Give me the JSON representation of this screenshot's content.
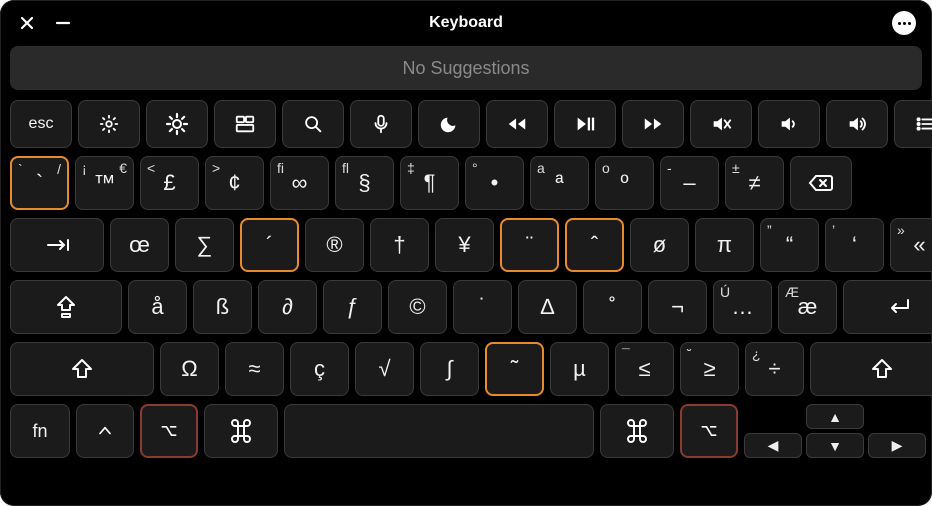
{
  "window": {
    "title": "Keyboard"
  },
  "suggestions": {
    "text": "No Suggestions"
  },
  "colors": {
    "highlight_orange": "#e88b2e",
    "highlight_red": "#8b3a2e",
    "key_bg": "#1b1b1b",
    "key_border": "#3a3a3a",
    "bg": "#000000"
  },
  "fn_row": {
    "esc": "esc",
    "icons": [
      "brightness-down",
      "brightness-up",
      "mission-control",
      "search",
      "dictation",
      "do-not-disturb",
      "rewind",
      "play-pause",
      "fast-forward",
      "mute",
      "volume-down",
      "volume-up",
      "list"
    ]
  },
  "row1": [
    {
      "tl": "`",
      "tr": "/",
      "c": "`",
      "hl": "orange"
    },
    {
      "tl": "¡",
      "tr": "€",
      "c": "™"
    },
    {
      "tl": "<",
      "tr": "",
      "c": "£"
    },
    {
      "tl": ">",
      "tr": "",
      "c": "¢"
    },
    {
      "tl": "fi",
      "tr": "",
      "c": "∞"
    },
    {
      "tl": "fl",
      "tr": "",
      "c": "§"
    },
    {
      "tl": "‡",
      "tr": "",
      "c": "¶"
    },
    {
      "tl": "°",
      "tr": "",
      "c": "•"
    },
    {
      "tl": "a",
      "tr": "",
      "c": "ª"
    },
    {
      "tl": "o",
      "tr": "",
      "c": "º"
    },
    {
      "tl": "-",
      "tr": "",
      "c": "–"
    },
    {
      "tl": "±",
      "tr": "",
      "c": "≠"
    }
  ],
  "row1_backspace_icon": "backspace",
  "row2_tab_icon": "tab",
  "row2": [
    {
      "c": "œ"
    },
    {
      "c": "∑"
    },
    {
      "c": "´",
      "hl": "orange"
    },
    {
      "c": "®"
    },
    {
      "c": "†"
    },
    {
      "c": "¥"
    },
    {
      "c": "¨",
      "hl": "orange"
    },
    {
      "c": "ˆ",
      "hl": "orange"
    },
    {
      "c": "ø"
    },
    {
      "c": "π"
    },
    {
      "tl": "”",
      "c": "“"
    },
    {
      "tl": "’",
      "c": "‘"
    },
    {
      "tl": "»",
      "c": "«"
    }
  ],
  "row3_caps_icon": "caps-lock",
  "row3": [
    {
      "c": "å"
    },
    {
      "c": "ß"
    },
    {
      "c": "∂"
    },
    {
      "c": "ƒ"
    },
    {
      "c": "©"
    },
    {
      "c": "˙"
    },
    {
      "c": "∆"
    },
    {
      "c": "˚"
    },
    {
      "c": "¬"
    },
    {
      "tl": "Ú",
      "c": "…"
    },
    {
      "tl": "Æ",
      "c": "æ"
    }
  ],
  "row3_return_icon": "return",
  "row4_shift_icon": "shift",
  "row4": [
    {
      "c": "Ω"
    },
    {
      "c": "≈"
    },
    {
      "c": "ç"
    },
    {
      "c": "√"
    },
    {
      "c": "∫"
    },
    {
      "c": "˜",
      "hl": "orange"
    },
    {
      "c": "µ"
    },
    {
      "tl": "¯",
      "c": "≤"
    },
    {
      "tl": "˘",
      "c": "≥"
    },
    {
      "tl": "¿",
      "c": "÷"
    }
  ],
  "bottom": {
    "fn": "fn",
    "ctrl_icon": "control",
    "opt_icon": "option",
    "cmd_icon": "command",
    "arrows": {
      "up": "▲",
      "down": "▼",
      "left": "◀",
      "right": "▶"
    }
  }
}
